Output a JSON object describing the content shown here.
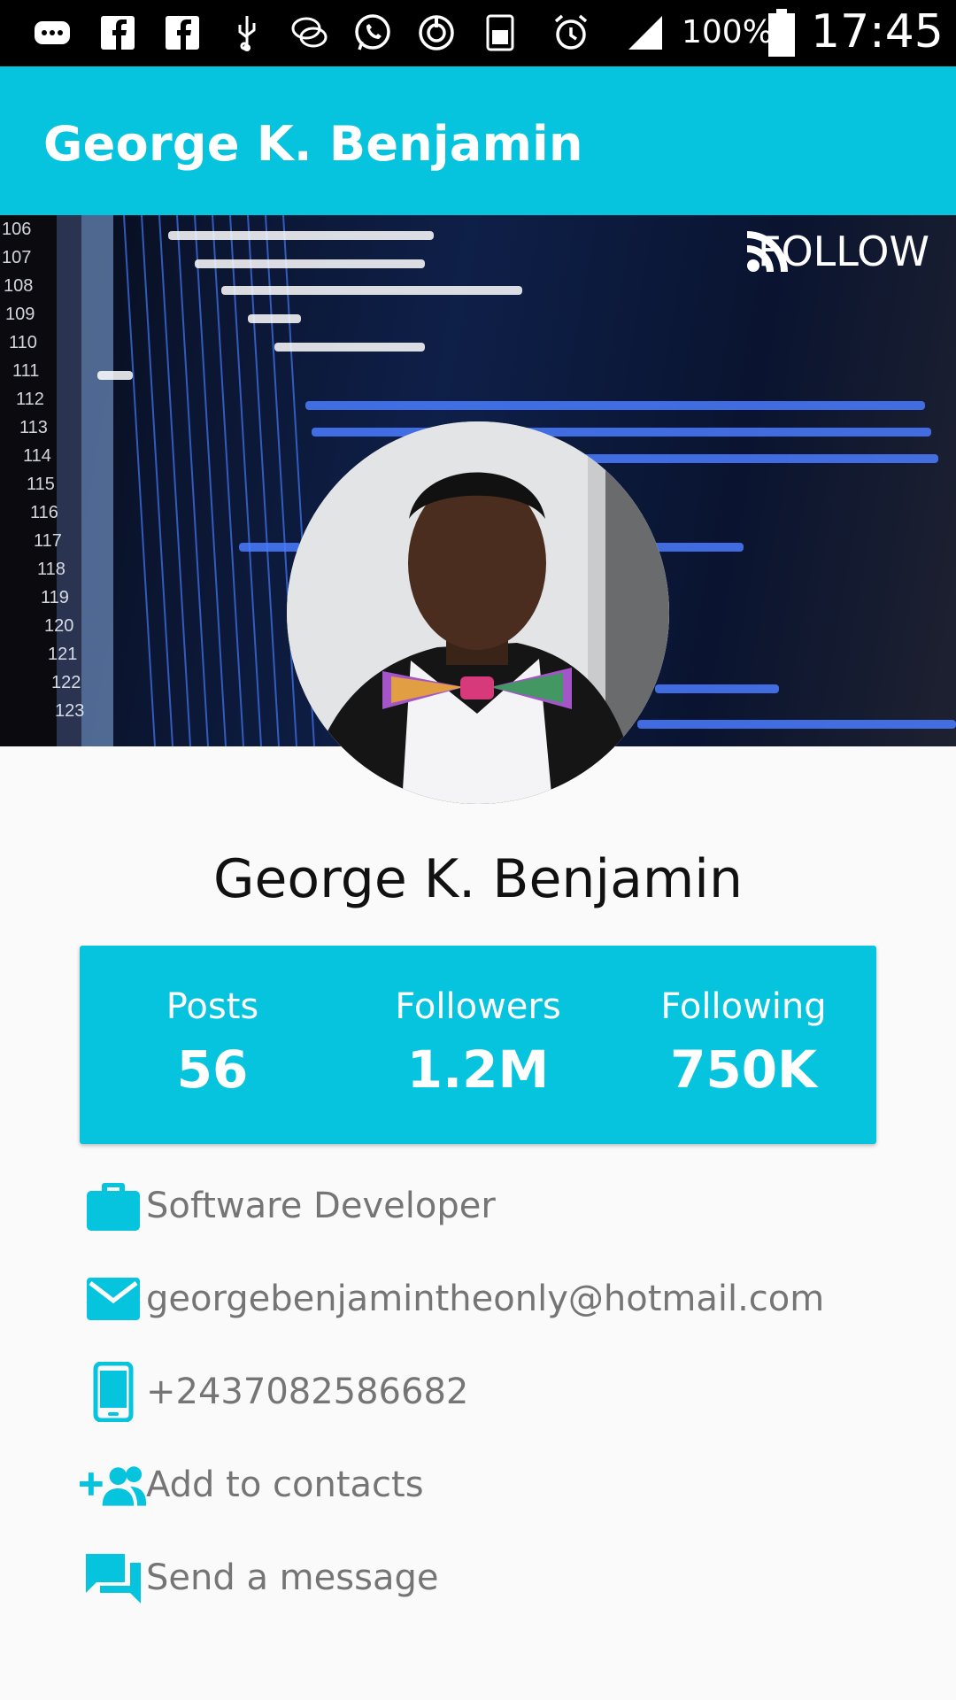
{
  "status_bar": {
    "icons": [
      "message-icon",
      "facebook-icon",
      "facebook-icon",
      "usb-icon",
      "chat-icon",
      "whatsapp-icon",
      "sync-icon",
      "sim-icon",
      "alarm-icon",
      "signal-icon",
      "battery-icon"
    ],
    "battery": "100%",
    "time": "17:45"
  },
  "app_bar": {
    "title": "George K. Benjamin"
  },
  "cover": {
    "follow_label": "FOLLOW"
  },
  "profile": {
    "name": "George K. Benjamin"
  },
  "stats": [
    {
      "label": "Posts",
      "value": "56"
    },
    {
      "label": "Followers",
      "value": "1.2M"
    },
    {
      "label": "Following",
      "value": "750K"
    }
  ],
  "info": {
    "job": "Software Developer",
    "email": "georgebenjamintheonly@hotmail.com",
    "phone": "+2437082586682",
    "add_contact": "Add to contacts",
    "send_message": "Send a message"
  },
  "colors": {
    "accent": "#07c4de",
    "text_secondary": "#757575",
    "background": "#fafafa"
  }
}
